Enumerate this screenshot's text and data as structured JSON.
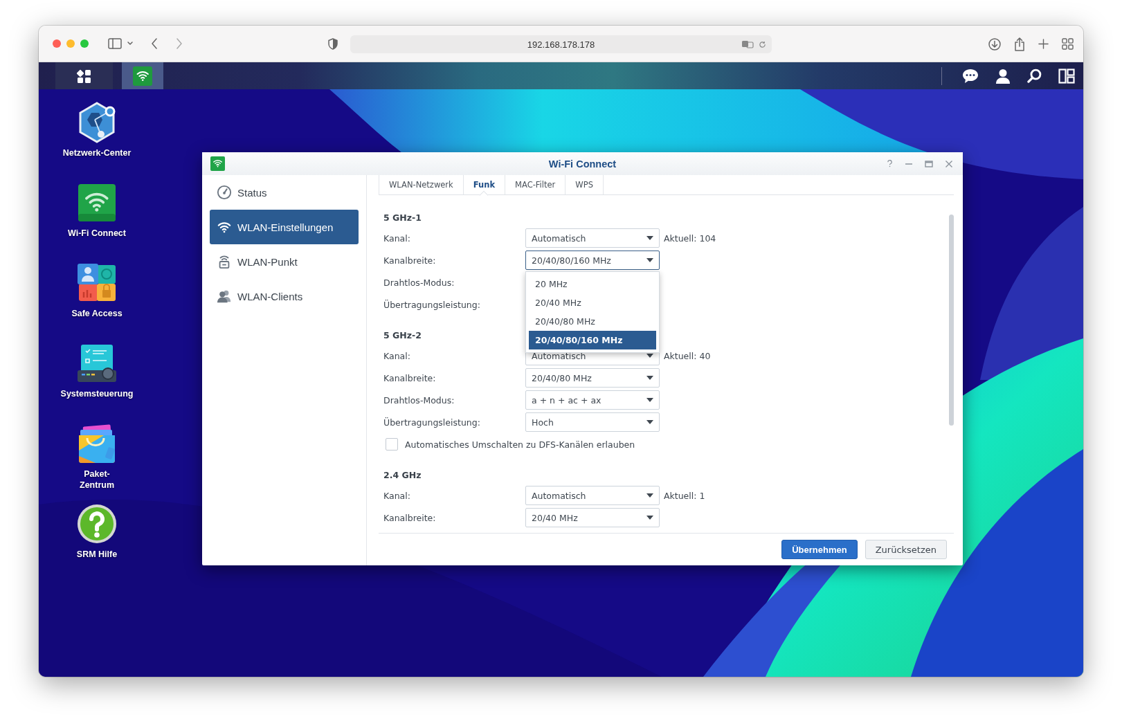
{
  "browser": {
    "address": "192.168.178.178"
  },
  "taskbar": {
    "open_apps": [
      {
        "kind": "wifi",
        "selected": true
      }
    ]
  },
  "desktop_icons": [
    {
      "kind": "network",
      "label": "Netzwerk-Center"
    },
    {
      "kind": "wifi",
      "label": "Wi-Fi Connect"
    },
    {
      "kind": "safe",
      "label": "Safe Access"
    },
    {
      "kind": "control",
      "label": "Systemsteuerung"
    },
    {
      "kind": "package",
      "label": "Paket-\nZentrum"
    },
    {
      "kind": "help",
      "label": "SRM Hilfe"
    }
  ],
  "window": {
    "title": "Wi-Fi Connect",
    "sidebar": [
      {
        "kind": "status",
        "label": "Status",
        "selected": false
      },
      {
        "kind": "wifi",
        "label": "WLAN-Einstellungen",
        "selected": true
      },
      {
        "kind": "point",
        "label": "WLAN-Punkt",
        "selected": false
      },
      {
        "kind": "clients",
        "label": "WLAN-Clients",
        "selected": false
      }
    ],
    "tabs": [
      {
        "label": "WLAN-Netzwerk",
        "selected": false
      },
      {
        "label": "Funk",
        "selected": true
      },
      {
        "label": "MAC-Filter",
        "selected": false
      },
      {
        "label": "WPS",
        "selected": false
      }
    ],
    "sections": [
      {
        "title": "5 GHz-1",
        "rows": [
          {
            "kind": "select",
            "label": "Kanal:",
            "value": "Automatisch",
            "note": "Aktuell: 104",
            "focused": false
          },
          {
            "kind": "select",
            "label": "Kanalbreite:",
            "value": "20/40/80/160 MHz",
            "focused": true,
            "options": [
              {
                "label": "20 MHz",
                "selected": false
              },
              {
                "label": "20/40 MHz",
                "selected": false
              },
              {
                "label": "20/40/80 MHz",
                "selected": false
              },
              {
                "label": "20/40/80/160 MHz",
                "selected": true
              }
            ]
          },
          {
            "kind": "covered",
            "label": "Drahtlos-Modus:"
          },
          {
            "kind": "covered",
            "label": "Übertragungsleistung:"
          }
        ]
      },
      {
        "title": "5 GHz-2",
        "rows": [
          {
            "kind": "select",
            "label": "Kanal:",
            "value": "Automatisch",
            "note": "Aktuell: 40",
            "focused": false
          },
          {
            "kind": "select",
            "label": "Kanalbreite:",
            "value": "20/40/80 MHz",
            "focused": false
          },
          {
            "kind": "select",
            "label": "Drahtlos-Modus:",
            "value": "a + n + ac + ax",
            "focused": false
          },
          {
            "kind": "select",
            "label": "Übertragungsleistung:",
            "value": "Hoch",
            "focused": false
          },
          {
            "kind": "checkbox",
            "label": "Automatisches Umschalten zu DFS-Kanälen erlauben",
            "checked": false
          }
        ]
      },
      {
        "title": "2.4 GHz",
        "rows": [
          {
            "kind": "select",
            "label": "Kanal:",
            "value": "Automatisch",
            "note": "Aktuell: 1",
            "focused": false
          },
          {
            "kind": "select",
            "label": "Kanalbreite:",
            "value": "20/40 MHz",
            "focused": false
          }
        ]
      }
    ],
    "buttons": [
      {
        "kind": "primary",
        "label": "Übernehmen"
      },
      {
        "kind": "secondary",
        "label": "Zurücksetzen"
      }
    ]
  }
}
